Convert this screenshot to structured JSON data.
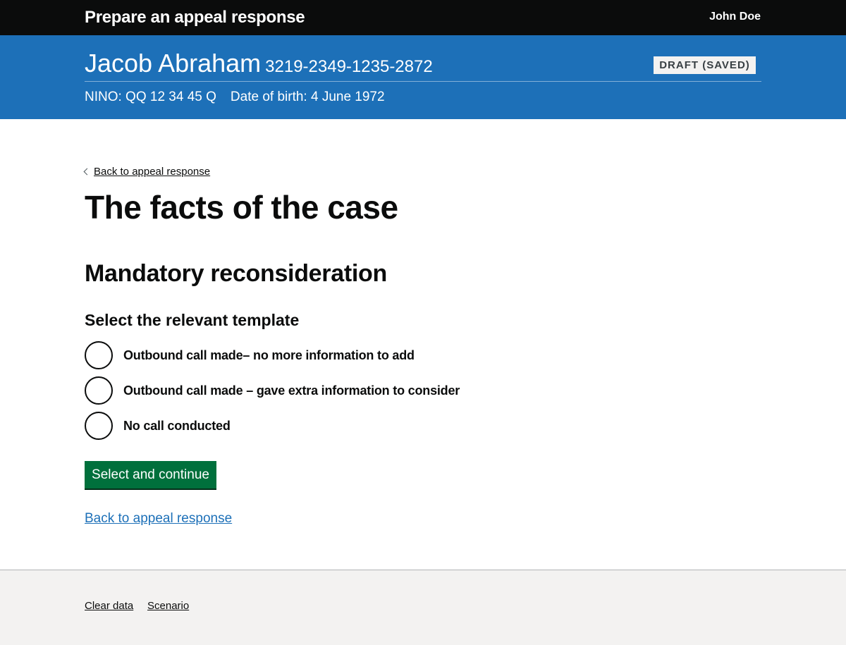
{
  "header": {
    "service_name": "Prepare an appeal response",
    "user_name": "John Doe"
  },
  "banner": {
    "name": "Jacob Abraham",
    "reference": "3219-2349-1235-2872",
    "status_tag": "DRAFT (SAVED)",
    "nino": "NINO: QQ 12 34 45 Q",
    "dob": "Date of birth: 4 June 1972"
  },
  "main": {
    "back_small": "Back to appeal response",
    "title": "The facts of the case",
    "section_heading": "Mandatory reconsideration",
    "legend": "Select the relevant template",
    "options": [
      {
        "label": "Outbound call made– no more information to add",
        "selected": false
      },
      {
        "label": "Outbound call made – gave extra information to consider",
        "selected": false
      },
      {
        "label": "No call conducted",
        "selected": false
      }
    ],
    "submit_label": "Select and continue",
    "back_link": "Back to appeal response"
  },
  "footer": {
    "links": [
      "Clear data",
      "Scenario"
    ]
  },
  "colors": {
    "header_bg": "#0b0c0c",
    "banner_bg": "#1d70b8",
    "button_bg": "#00703c",
    "link": "#1d70b8",
    "footer_bg": "#f3f2f1"
  }
}
